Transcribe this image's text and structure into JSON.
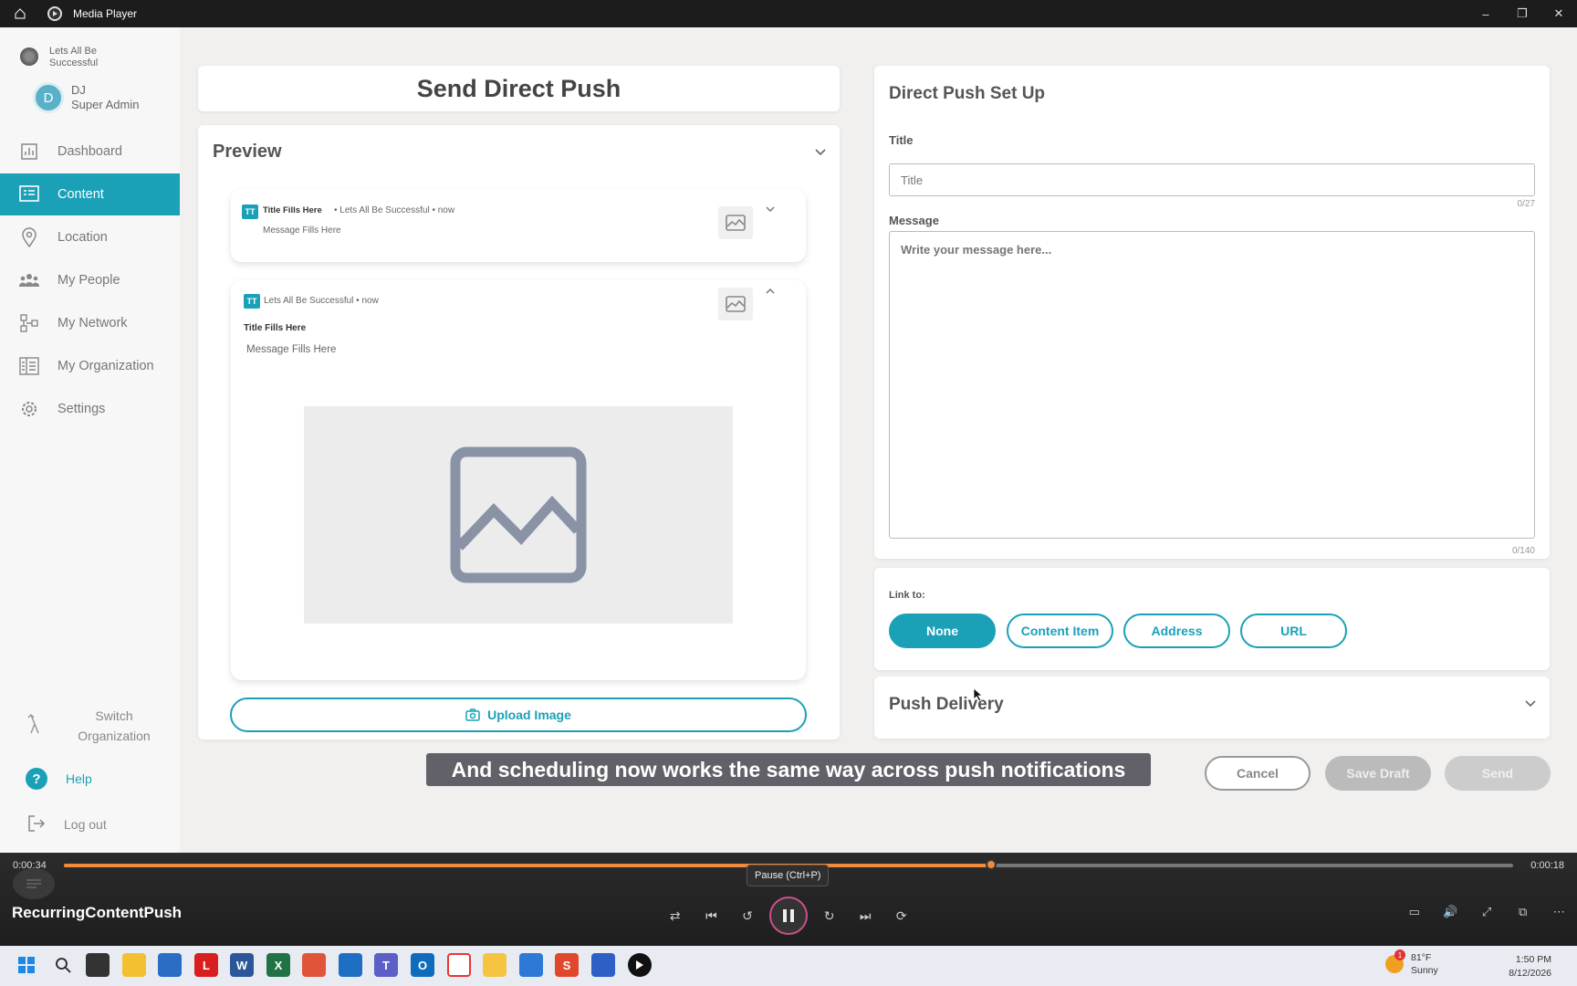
{
  "window": {
    "title": "Media Player"
  },
  "sidebar": {
    "org_name": "Lets All Be Successful",
    "user": {
      "initial": "D",
      "name": "DJ",
      "role": "Super Admin"
    },
    "items": [
      {
        "label": "Dashboard",
        "icon": "chart-icon"
      },
      {
        "label": "Content",
        "icon": "content-icon",
        "active": true
      },
      {
        "label": "Location",
        "icon": "location-pin-icon"
      },
      {
        "label": "My People",
        "icon": "people-icon"
      },
      {
        "label": "My Network",
        "icon": "network-icon"
      },
      {
        "label": "My Organization",
        "icon": "organization-icon"
      },
      {
        "label": "Settings",
        "icon": "gear-icon"
      }
    ],
    "switch_org": "Switch Organization",
    "help": "Help",
    "logout": "Log out"
  },
  "main": {
    "header": "Send Direct Push",
    "preview": {
      "heading": "Preview",
      "collapsed": {
        "title": "Title Fills Here",
        "meta": "• Lets All Be Successful • now",
        "message": "Message Fills Here",
        "app_badge": "TT"
      },
      "expanded": {
        "meta": "Lets All Be Successful • now",
        "title": "Title Fills Here",
        "message": "Message Fills Here",
        "app_badge": "TT"
      },
      "upload_label": "Upload Image"
    },
    "setup": {
      "heading": "Direct Push Set Up",
      "title_label": "Title",
      "title_placeholder": "Title",
      "title_count": "0/27",
      "message_label": "Message",
      "message_placeholder": "Write your message here...",
      "message_count": "0/140",
      "link_label": "Link to:",
      "link_options": [
        "None",
        "Content Item",
        "Address",
        "URL"
      ],
      "link_selected": "None"
    },
    "delivery_heading": "Push Delivery",
    "buttons": {
      "cancel": "Cancel",
      "save_draft": "Save Draft",
      "send": "Send"
    }
  },
  "caption": "And scheduling now works the same way across push notifications",
  "player": {
    "elapsed": "0:00:34",
    "remaining": "0:00:18",
    "progress_fraction": 0.64,
    "tooltip": "Pause (Ctrl+P)",
    "video_title": "RecurringContentPush"
  },
  "taskbar": {
    "weather_temp": "81°F",
    "weather_desc": "Sunny",
    "weather_badge": "1",
    "time": "1:50 PM",
    "date": "8/12/2026"
  },
  "colors": {
    "accent": "#1aa1b8",
    "progress": "#f08a3c"
  }
}
